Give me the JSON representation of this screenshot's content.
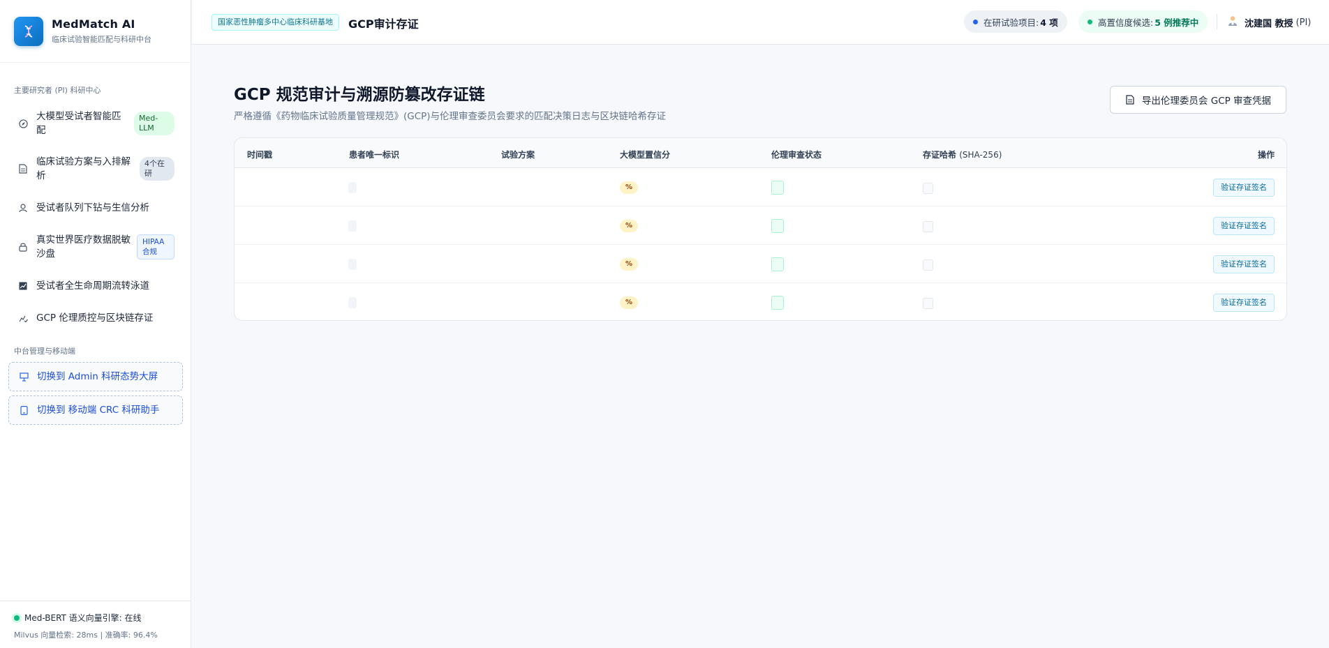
{
  "brand": {
    "name": "MedMatch AI",
    "subtitle": "临床试验智能匹配与科研中台"
  },
  "sidebar": {
    "section_main": "主要研究者 (PI) 科研中心",
    "items": [
      {
        "label": "大模型受试者智能匹配",
        "icon": "compass-icon",
        "badge": "Med-LLM"
      },
      {
        "label": "临床试验方案与入排解析",
        "icon": "document-icon",
        "badge": "4个在研"
      },
      {
        "label": "受试者队列下钻与生信分析",
        "icon": "user-icon",
        "badge": ""
      },
      {
        "label": "真实世界医疗数据脱敏沙盘",
        "icon": "lock-icon",
        "badge": "HIPAA合规"
      },
      {
        "label": "受试者全生命周期流转泳道",
        "icon": "chart-icon",
        "badge": ""
      },
      {
        "label": "GCP 伦理质控与区块链存证",
        "icon": "audit-icon",
        "badge": ""
      }
    ],
    "section_admin": "中台管理与移动端",
    "switch_admin": "切换到 Admin 科研态势大屏",
    "switch_mobile": "切换到 移动端 CRC 科研助手",
    "engine_status": "Med-BERT 语义向量引擎: 在线",
    "engine_metrics": "Milvus 向量检索: 28ms | 准确率: 96.4%"
  },
  "header": {
    "site_tag": "国家恶性肿瘤多中心临床科研基地",
    "title": "GCP审计存证",
    "trials_label": "在研试验项目:",
    "trials_value": "4 项",
    "recommend_label": "高置信度候选:",
    "recommend_value": "5 例推荐中",
    "user_name": "沈建国 教授",
    "user_role": "(PI)"
  },
  "main": {
    "title": "GCP 规范审计与溯源防篡改存证链",
    "subtitle": "严格遵循《药物临床试验质量管理规范》(GCP)与伦理审查委员会要求的匹配决策日志与区块链哈希存证",
    "export_button": "导出伦理委员会 GCP 审查凭据"
  },
  "table": {
    "columns": [
      "时间戳",
      "患者唯一标识",
      "试验方案",
      "大模型置信分",
      "伦理审查状态",
      "存证哈希",
      "(SHA-256)",
      "操作"
    ],
    "rows": [
      {
        "score": "%",
        "action": "验证存证签名"
      },
      {
        "score": "%",
        "action": "验证存证签名"
      },
      {
        "score": "%",
        "action": "验证存证签名"
      },
      {
        "score": "%",
        "action": "验证存证签名"
      }
    ]
  },
  "colors": {
    "accent": "#2563eb",
    "success": "#10b981",
    "brand_logo": "#1e88e5"
  }
}
